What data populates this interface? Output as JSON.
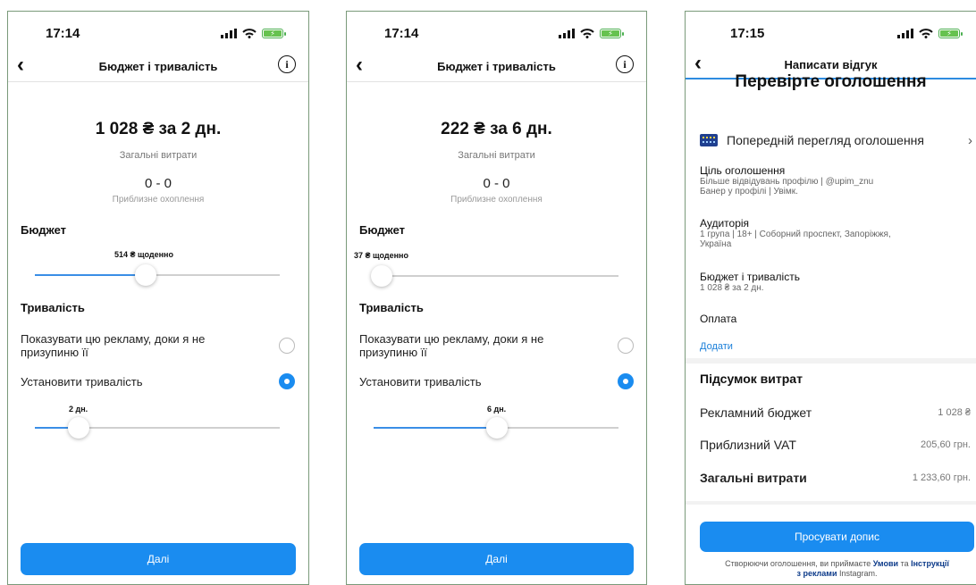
{
  "panels": [
    {
      "time": "17:14",
      "title": "Бюджет і тривалість",
      "total": "1 028 ₴ за 2 дн.",
      "total_label": "Загальні витрати",
      "reach": "0 - 0",
      "reach_label": "Приблизне охоплення",
      "budget_heading": "Бюджет",
      "budget_value": "514 ₴ щоденно",
      "budget_slider": 0.45,
      "duration_heading": "Тривалість",
      "option_until_pause": "Показувати цю рекламу, доки я не призупиню її",
      "option_set_duration": "Установити тривалість",
      "duration_value": "2 дн.",
      "duration_slider": 0.18,
      "next": "Далі"
    },
    {
      "time": "17:14",
      "title": "Бюджет і тривалість",
      "total": "222 ₴ за 6 дн.",
      "total_label": "Загальні витрати",
      "reach": "0 - 0",
      "reach_label": "Приблизне охоплення",
      "budget_heading": "Бюджет",
      "budget_value": "37 ₴ щоденно",
      "budget_slider": 0.03,
      "duration_heading": "Тривалість",
      "option_until_pause": "Показувати цю рекламу, доки я не призупиню її",
      "option_set_duration": "Установити тривалість",
      "duration_value": "6 дн.",
      "duration_slider": 0.5,
      "next": "Далі"
    }
  ],
  "review": {
    "time": "17:15",
    "title": "Написати відгук",
    "heading": "Перевірте оголошення",
    "preview": "Попередній перегляд оголошення",
    "goal_title": "Ціль оголошення",
    "goal_line1": "Більше відвідувань профілю | @upim_znu",
    "goal_line2": "Банер у профілі | Увімк.",
    "audience_title": "Аудиторія",
    "audience_line1": "1 група | 18+ | Соборний проспект, Запоріжжя,",
    "audience_line2": "Україна",
    "budget_title": "Бюджет і тривалість",
    "budget_line": "1 028 ₴ за 2 дн.",
    "payment_title": "Оплата",
    "payment_add": "Додати",
    "summary_title": "Підсумок витрат",
    "ad_budget": "Рекламний бюджет",
    "ad_budget_value": "1 028 ₴",
    "vat": "Приблизний VAT",
    "vat_value": "205,60 грн.",
    "total": "Загальні витрати",
    "total_value": "1 233,60 грн.",
    "promote": "Просувати допис",
    "legal_1": "Створюючи оголошення, ви приймаєте",
    "legal_terms": "Умови",
    "legal_and": "та",
    "legal_guides": "Інструкції",
    "legal_ads": "з реклами",
    "legal_end": "Instagram."
  }
}
